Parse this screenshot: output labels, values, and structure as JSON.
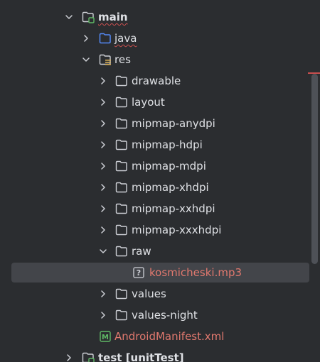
{
  "tree": {
    "main": {
      "label": "main",
      "expanded": true,
      "icon": "module-folder-icon"
    },
    "java": {
      "label": "java",
      "expanded": false,
      "icon": "source-folder-icon"
    },
    "res": {
      "label": "res",
      "expanded": true,
      "icon": "resource-folder-icon"
    },
    "res_children": [
      {
        "label": "drawable",
        "expanded": false
      },
      {
        "label": "layout",
        "expanded": false
      },
      {
        "label": "mipmap-anydpi",
        "expanded": false
      },
      {
        "label": "mipmap-hdpi",
        "expanded": false
      },
      {
        "label": "mipmap-mdpi",
        "expanded": false
      },
      {
        "label": "mipmap-xhdpi",
        "expanded": false
      },
      {
        "label": "mipmap-xxhdpi",
        "expanded": false
      },
      {
        "label": "mipmap-xxxhdpi",
        "expanded": false
      }
    ],
    "raw": {
      "label": "raw",
      "expanded": true
    },
    "raw_file": {
      "label": "kosmicheski.mp3",
      "icon": "unknown-file-icon",
      "selected": true
    },
    "values": {
      "label": "values",
      "expanded": false
    },
    "values_night": {
      "label": "values-night",
      "expanded": false
    },
    "manifest": {
      "label": "AndroidManifest.xml",
      "icon": "manifest-file-icon"
    },
    "test": {
      "label": "test",
      "suffix": "[unitTest]",
      "expanded": false
    }
  },
  "colors": {
    "background": "#2b2d30",
    "text": "#dfe1e5",
    "selected_row": "#43454a",
    "modified_text": "#e0786e",
    "folder_outline": "#ced0d6",
    "source_folder": "#548af7",
    "manifest_icon": "#5fb865"
  }
}
